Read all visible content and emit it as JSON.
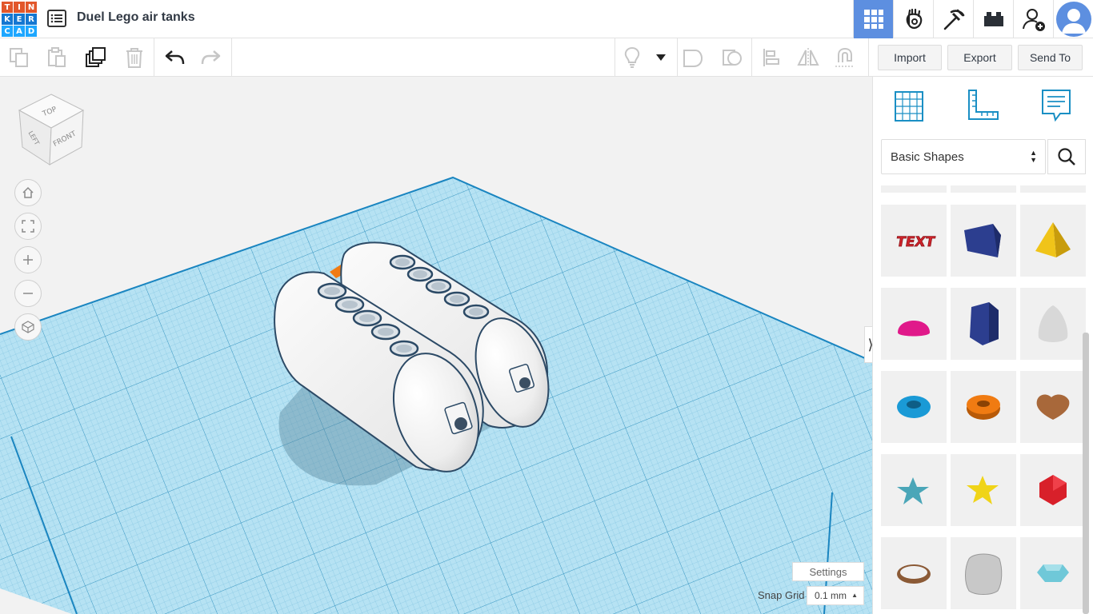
{
  "app": {
    "logo_letters": [
      "T",
      "I",
      "N",
      "K",
      "E",
      "R",
      "C",
      "A",
      "D"
    ],
    "logo_colors": [
      "#e2572b",
      "#e2572b",
      "#e2572b",
      "#1477d1",
      "#1477d1",
      "#1477d1",
      "#1ea7ff",
      "#1ea7ff",
      "#1ea7ff"
    ],
    "document_title": "Duel Lego air tanks",
    "accent": "#5d8fe0"
  },
  "top_nav": {
    "items": [
      {
        "name": "3d-design-grid-icon",
        "active": true
      },
      {
        "name": "circuits-hand-icon",
        "active": false
      },
      {
        "name": "pickaxe-icon",
        "active": false
      },
      {
        "name": "bricks-icon",
        "active": false
      },
      {
        "name": "add-user-icon",
        "active": false
      }
    ]
  },
  "toolbar": {
    "import_label": "Import",
    "export_label": "Export",
    "send_to_label": "Send To"
  },
  "viewport": {
    "view_cube": {
      "top": "TOP",
      "left": "LEFT",
      "front": "FRONT"
    },
    "settings_label": "Settings",
    "snap_grid_label": "Snap Grid",
    "snap_grid_value": "0.1 mm",
    "workplane_color": "#a8dcf0",
    "object_color": "#f5f5f5"
  },
  "panel": {
    "category_select": "Basic Shapes",
    "shapes": [
      {
        "name": "text-shape",
        "color": "#d0242b"
      },
      {
        "name": "box-shape",
        "color": "#2c3e8f"
      },
      {
        "name": "pyramid-shape",
        "color": "#f0c419"
      },
      {
        "name": "half-sphere-shape",
        "color": "#e0198a"
      },
      {
        "name": "polygon-shape",
        "color": "#2c3e8f"
      },
      {
        "name": "paraboloid-shape",
        "color": "#d8d8d8"
      },
      {
        "name": "torus-shape",
        "color": "#1a9ad6"
      },
      {
        "name": "tube-shape",
        "color": "#f07b12"
      },
      {
        "name": "heart-shape",
        "color": "#a8683a"
      },
      {
        "name": "star-shape",
        "color": "#4aa6b8"
      },
      {
        "name": "star-yellow-shape",
        "color": "#f0d418"
      },
      {
        "name": "icosahedron-shape",
        "color": "#d8202a"
      },
      {
        "name": "ring-shape",
        "color": "#8b5a36"
      },
      {
        "name": "rounded-box-shape",
        "color": "#c8c8c8"
      },
      {
        "name": "gem-shape",
        "color": "#6fc8d8"
      }
    ]
  }
}
